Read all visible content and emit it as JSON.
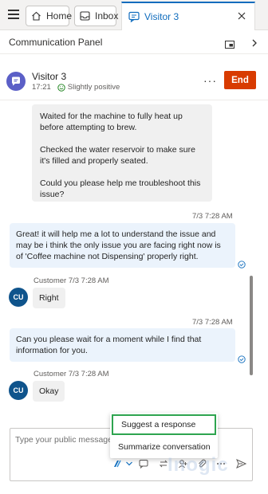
{
  "tabs": {
    "home_label": "Home",
    "inbox_label": "Inbox",
    "active_label": "Visitor 3"
  },
  "panel": {
    "title": "Communication Panel"
  },
  "visitor": {
    "name": "Visitor 3",
    "time": "17:21",
    "sentiment": "Slightly positive",
    "end_label": "End",
    "avatar_color": "#5b5fc7"
  },
  "messages": {
    "m1": {
      "p1": "Waited for the machine to fully heat up before attempting to brew.",
      "p2": "Checked the water reservoir to make sure it's filled and properly seated.",
      "p3": "Could you please help me troubleshoot this issue?"
    },
    "t1": "7/3 7:28 AM",
    "m2": "Great! it will help me a lot to understand the issue and may be i think the only issue you are facing right now is of 'Coffee machine not Dispensing' properly right.",
    "s1": "Customer 7/3 7:28 AM",
    "cu1": "CU",
    "m3": "Right",
    "t2": "7/3 7:28 AM",
    "m4": "Can you please wait for a moment while I find that information for you.",
    "s2": "Customer 7/3 7:28 AM",
    "cu2": "CU",
    "m5": "Okay"
  },
  "compose": {
    "placeholder": "Type your public message"
  },
  "menu": {
    "suggest": "Suggest a response",
    "summarize": "Summarize conversation"
  },
  "watermark": "Inogic",
  "colors": {
    "accent": "#0f6cbd",
    "end_button": "#d83b01",
    "highlight_border": "#2ea44f"
  }
}
